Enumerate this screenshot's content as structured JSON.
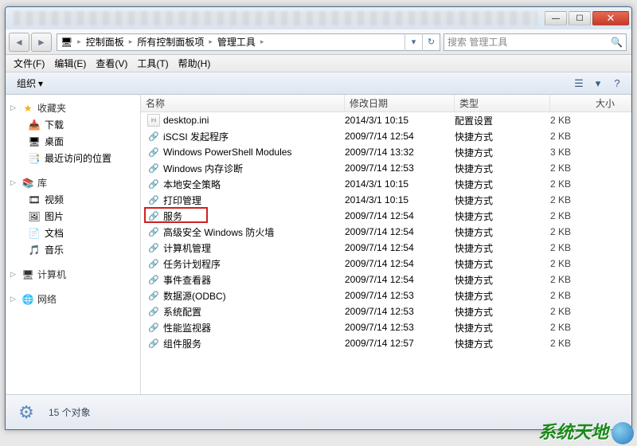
{
  "titlebar": {
    "min_glyph": "—",
    "max_glyph": "☐",
    "close_glyph": "✕"
  },
  "nav": {
    "back_glyph": "◄",
    "fwd_glyph": "►",
    "dropdown_glyph": "▾",
    "refresh_glyph": "↻",
    "search_glyph": "🔍"
  },
  "breadcrumb": {
    "root_glyph": "🖥",
    "sep": "▸",
    "items": [
      "控制面板",
      "所有控制面板项",
      "管理工具"
    ]
  },
  "search": {
    "placeholder": "搜索 管理工具"
  },
  "menubar": {
    "items": [
      "文件(F)",
      "编辑(E)",
      "查看(V)",
      "工具(T)",
      "帮助(H)"
    ]
  },
  "toolbar": {
    "organize": "组织",
    "dropdown_glyph": "▾",
    "view_glyph": "☰",
    "help_glyph": "?"
  },
  "sidebar": {
    "groups": [
      {
        "label": "收藏夹",
        "icon": "★",
        "iconClass": "star",
        "items": [
          {
            "label": "下载",
            "icon": "📥"
          },
          {
            "label": "桌面",
            "icon": "🖥"
          },
          {
            "label": "最近访问的位置",
            "icon": "📑"
          }
        ]
      },
      {
        "label": "库",
        "icon": "📚",
        "iconClass": "lib",
        "items": [
          {
            "label": "视频",
            "icon": "🎞"
          },
          {
            "label": "图片",
            "icon": "🖼"
          },
          {
            "label": "文档",
            "icon": "📄"
          },
          {
            "label": "音乐",
            "icon": "🎵"
          }
        ]
      },
      {
        "label": "计算机",
        "icon": "🖥",
        "iconClass": "",
        "items": []
      },
      {
        "label": "网络",
        "icon": "🌐",
        "iconClass": "",
        "items": []
      }
    ]
  },
  "columns": {
    "name": "名称",
    "date": "修改日期",
    "type": "类型",
    "size": "大小"
  },
  "files": [
    {
      "name": "desktop.ini",
      "date": "2014/3/1 10:15",
      "type": "配置设置",
      "size": "2 KB",
      "icon": "ini"
    },
    {
      "name": "iSCSI 发起程序",
      "date": "2009/7/14 12:54",
      "type": "快捷方式",
      "size": "2 KB",
      "icon": "lnk"
    },
    {
      "name": "Windows PowerShell Modules",
      "date": "2009/7/14 13:32",
      "type": "快捷方式",
      "size": "3 KB",
      "icon": "lnk"
    },
    {
      "name": "Windows 内存诊断",
      "date": "2009/7/14 12:53",
      "type": "快捷方式",
      "size": "2 KB",
      "icon": "lnk"
    },
    {
      "name": "本地安全策略",
      "date": "2014/3/1 10:15",
      "type": "快捷方式",
      "size": "2 KB",
      "icon": "lnk"
    },
    {
      "name": "打印管理",
      "date": "2014/3/1 10:15",
      "type": "快捷方式",
      "size": "2 KB",
      "icon": "lnk"
    },
    {
      "name": "服务",
      "date": "2009/7/14 12:54",
      "type": "快捷方式",
      "size": "2 KB",
      "icon": "lnk",
      "highlight": true
    },
    {
      "name": "高级安全 Windows 防火墙",
      "date": "2009/7/14 12:54",
      "type": "快捷方式",
      "size": "2 KB",
      "icon": "lnk"
    },
    {
      "name": "计算机管理",
      "date": "2009/7/14 12:54",
      "type": "快捷方式",
      "size": "2 KB",
      "icon": "lnk"
    },
    {
      "name": "任务计划程序",
      "date": "2009/7/14 12:54",
      "type": "快捷方式",
      "size": "2 KB",
      "icon": "lnk"
    },
    {
      "name": "事件查看器",
      "date": "2009/7/14 12:54",
      "type": "快捷方式",
      "size": "2 KB",
      "icon": "lnk"
    },
    {
      "name": "数据源(ODBC)",
      "date": "2009/7/14 12:53",
      "type": "快捷方式",
      "size": "2 KB",
      "icon": "lnk"
    },
    {
      "name": "系统配置",
      "date": "2009/7/14 12:53",
      "type": "快捷方式",
      "size": "2 KB",
      "icon": "lnk"
    },
    {
      "name": "性能监视器",
      "date": "2009/7/14 12:53",
      "type": "快捷方式",
      "size": "2 KB",
      "icon": "lnk"
    },
    {
      "name": "组件服务",
      "date": "2009/7/14 12:57",
      "type": "快捷方式",
      "size": "2 KB",
      "icon": "lnk"
    }
  ],
  "status": {
    "icon": "⚙",
    "text": "15 个对象"
  },
  "watermark": {
    "text": "系统天地"
  }
}
